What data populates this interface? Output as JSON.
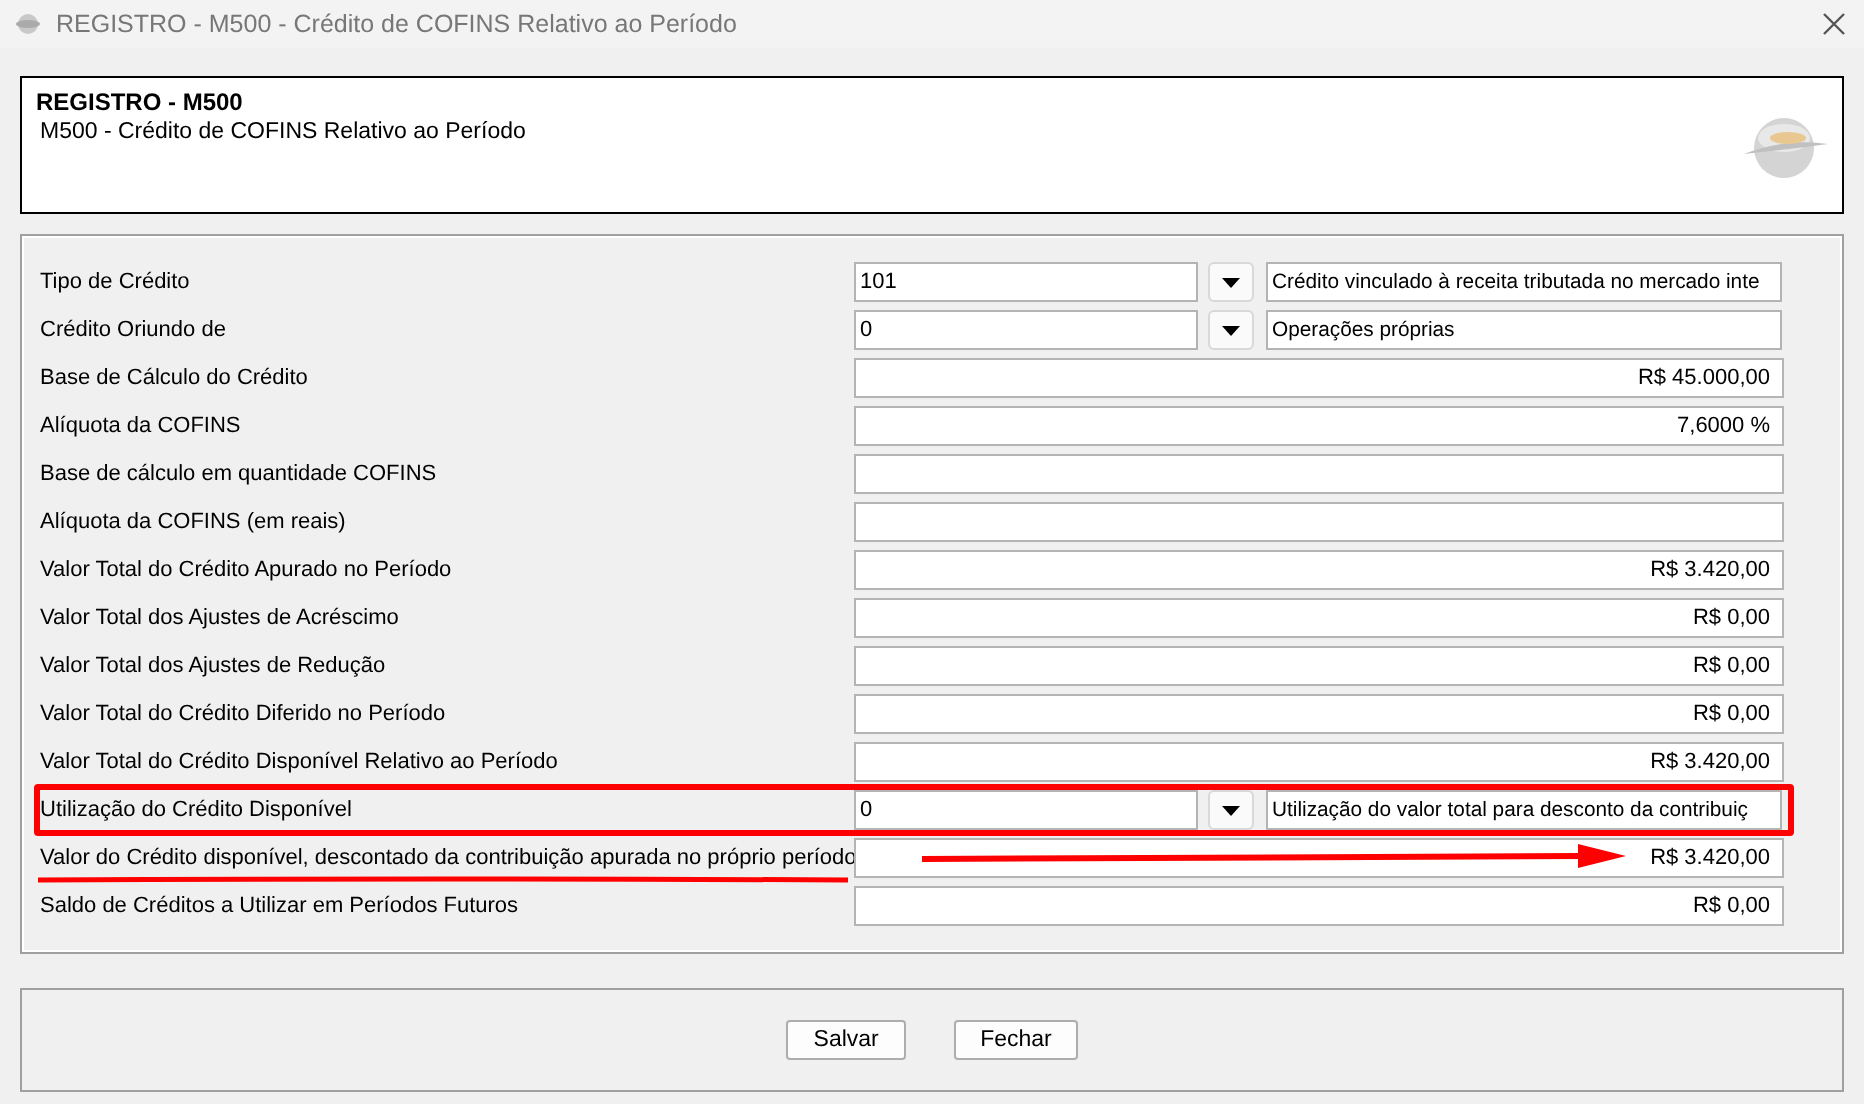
{
  "window": {
    "title": "REGISTRO - M500 - Crédito de COFINS Relativo ao Período"
  },
  "header": {
    "title": "REGISTRO - M500",
    "subtitle": "M500 - Crédito de COFINS Relativo ao Período"
  },
  "fields": [
    {
      "kind": "combo",
      "label": "Tipo de Crédito",
      "value": "101",
      "description": "Crédito vinculado à receita tributada no mercado inte"
    },
    {
      "kind": "combo",
      "label": "Crédito Oriundo de",
      "value": "0",
      "description": "Operações próprias"
    },
    {
      "kind": "amount",
      "label": "Base de Cálculo do Crédito",
      "value": "R$ 45.000,00"
    },
    {
      "kind": "amount",
      "label": "Alíquota da COFINS",
      "value": "7,6000 %"
    },
    {
      "kind": "amount",
      "label": "Base de cálculo em quantidade COFINS"
    },
    {
      "kind": "amount",
      "label": "Alíquota da COFINS (em reais)"
    },
    {
      "kind": "amount",
      "label": "Valor Total do Crédito Apurado no Período",
      "value": "R$ 3.420,00"
    },
    {
      "kind": "amount",
      "label": "Valor Total dos Ajustes de Acréscimo",
      "value": "R$ 0,00"
    },
    {
      "kind": "amount",
      "label": "Valor Total dos Ajustes de Redução",
      "value": "R$ 0,00"
    },
    {
      "kind": "amount",
      "label": "Valor Total do Crédito Diferido no Período",
      "value": "R$ 0,00"
    },
    {
      "kind": "amount",
      "label": "Valor Total do Crédito Disponível Relativo ao Período",
      "value": "R$ 3.420,00"
    },
    {
      "kind": "combo",
      "label": "Utilização do Crédito Disponível",
      "value": "0",
      "description": "Utilização do valor total para desconto da contribuiç",
      "highlighted": true
    },
    {
      "kind": "amount",
      "label": "Valor do Crédito disponível, descontado da contribuição apurada no próprio período",
      "value": "R$ 3.420,00",
      "underlined": true,
      "arrow": true
    },
    {
      "kind": "amount",
      "label": "Saldo de Créditos a Utilizar em Períodos Futuros",
      "value": "R$ 0,00"
    }
  ],
  "buttons": [
    "Salvar",
    "Fechar"
  ]
}
